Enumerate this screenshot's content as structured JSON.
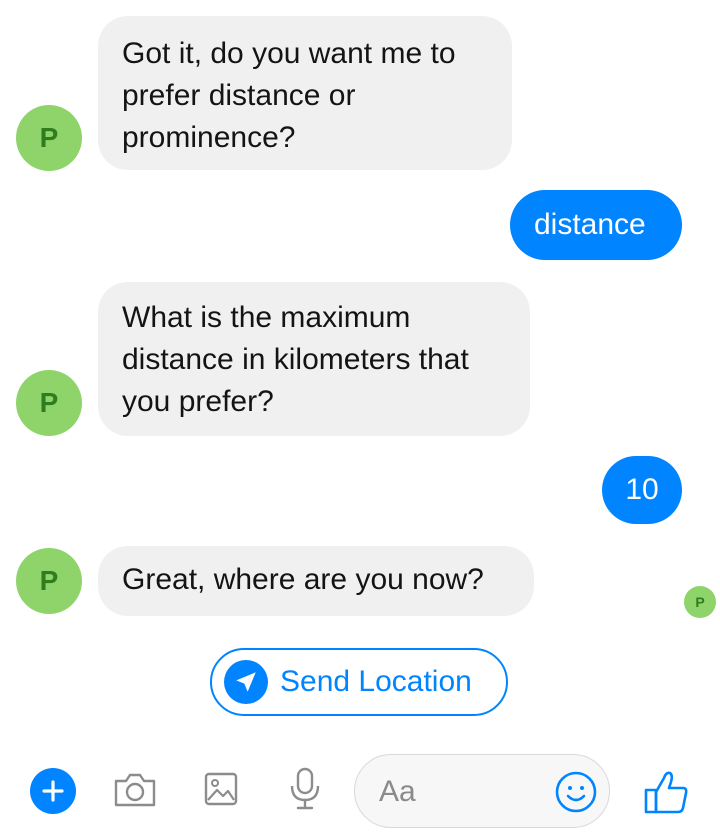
{
  "bot": {
    "avatar_letter": "P",
    "avatar_color": "#8fd46a"
  },
  "messages": [
    {
      "from": "bot",
      "text": "Got it, do you want me to prefer distance or prominence?"
    },
    {
      "from": "user",
      "text": "distance"
    },
    {
      "from": "bot",
      "text": "What is the maximum distance in kilometers that you prefer?"
    },
    {
      "from": "user",
      "text": "10"
    },
    {
      "from": "bot",
      "text": "Great, where are you now?"
    }
  ],
  "quick_reply": {
    "label": "Send Location",
    "icon": "location-arrow-icon"
  },
  "composer": {
    "placeholder": "Aa",
    "icons": [
      "plus-icon",
      "camera-icon",
      "image-icon",
      "microphone-icon",
      "emoji-icon",
      "thumbs-up-icon"
    ]
  },
  "colors": {
    "accent": "#0084ff",
    "incoming_bubble": "#f1f0f0"
  }
}
